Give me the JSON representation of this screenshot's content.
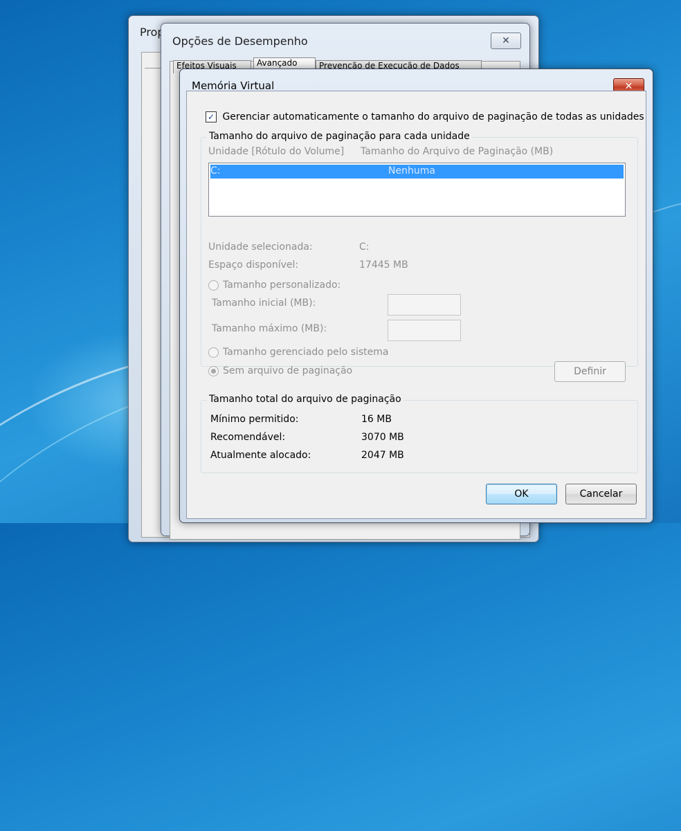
{
  "background_windows": {
    "system_properties": {
      "title": "Prop"
    },
    "performance_options": {
      "title": "Opções de Desempenho",
      "tabs": [
        "Efeitos Visuais",
        "Avançado",
        "Prevenção de Execução de Dados"
      ]
    }
  },
  "dialog": {
    "title": "Memória Virtual",
    "auto_manage": {
      "checked": true,
      "label": "Gerenciar automaticamente o tamanho do arquivo de paginação de todas as unidades"
    },
    "per_drive_group": {
      "label": "Tamanho do arquivo de paginação para cada unidade",
      "columns": [
        "Unidade [Rótulo do Volume]",
        "Tamanho do Arquivo de Paginação (MB)"
      ],
      "rows": [
        {
          "drive": "C:",
          "size": "Nenhuma",
          "selected": true
        }
      ],
      "selected_drive_label": "Unidade selecionada:",
      "selected_drive_value": "C:",
      "free_space_label": "Espaço disponível:",
      "free_space_value": "17445 MB",
      "custom_size_label": "Tamanho personalizado:",
      "initial_size_label": "Tamanho inicial (MB):",
      "initial_size_value": "",
      "max_size_label": "Tamanho máximo (MB):",
      "max_size_value": "",
      "system_managed_label": "Tamanho gerenciado pelo sistema",
      "no_paging_label": "Sem arquivo de paginação",
      "selected_option": "no_paging",
      "set_button": "Definir"
    },
    "total_group": {
      "label": "Tamanho total do arquivo de paginação",
      "min_label": "Mínimo permitido:",
      "min_value": "16 MB",
      "recommended_label": "Recomendável:",
      "recommended_value": "3070 MB",
      "allocated_label": "Atualmente alocado:",
      "allocated_value": "2047 MB"
    },
    "ok_button": "OK",
    "cancel_button": "Cancelar"
  },
  "colors": {
    "selection": "#3399ff",
    "close_button": "#c8432c",
    "desktop": "#1a86cf"
  },
  "icons": {
    "close": "close-icon",
    "check": "checkmark-icon"
  }
}
